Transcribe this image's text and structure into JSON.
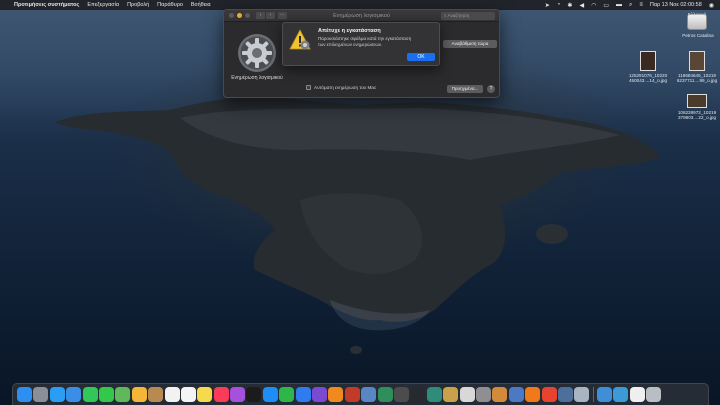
{
  "menubar": {
    "apple": "",
    "app_name": "Προτιμήσεις συστήματος",
    "items": [
      "Επεξεργασία",
      "Προβολή",
      "Παράθυρο",
      "Βοήθεια"
    ],
    "clock": "Παρ 13 Νοε  02:00:58",
    "input_language": "Ελληνικά"
  },
  "desktop": {
    "drive": {
      "label": "Petros Catalina"
    },
    "files": [
      {
        "label": "125291076_10220 450043....14_o.jpg"
      },
      {
        "label": "118684646_10219 6237711....99_o.jpg"
      },
      {
        "label": "106239972_10219 379803....22_o.jpg"
      }
    ]
  },
  "window": {
    "title": "Ενημέρωση λογισμικού",
    "search_placeholder": "Αναζήτηση",
    "pref_label": "Ενημέρωση λογισμικού",
    "update_button": "Αναβάθμιση τώρα",
    "auto_update_label": "Αυτόματη ενημέρωση του Mac",
    "advanced_button": "Προηγμένα...",
    "help_button": "?"
  },
  "alert": {
    "title": "Απέτυχε η εγκατάσταση",
    "message": "Παρουσιάστηκε σφάλμα κατά την εγκατάσταση των επιλεγμένων ενημερώσεων.",
    "ok_button": "OK"
  },
  "dock": {
    "icons": [
      {
        "name": "finder-icon",
        "color": "#2f8ff0"
      },
      {
        "name": "launchpad-icon",
        "color": "#8a8f98"
      },
      {
        "name": "safari-icon",
        "color": "#2a9df4"
      },
      {
        "name": "mail-icon",
        "color": "#3a8ee6"
      },
      {
        "name": "facetime-icon",
        "color": "#33c659"
      },
      {
        "name": "messages-icon",
        "color": "#34c84a"
      },
      {
        "name": "maps-icon",
        "color": "#5fb85a"
      },
      {
        "name": "photos-icon",
        "color": "#f5b638"
      },
      {
        "name": "contacts-icon",
        "color": "#b88a52"
      },
      {
        "name": "calendar-icon",
        "color": "#f2f2f2"
      },
      {
        "name": "reminders-icon",
        "color": "#f4f4f4"
      },
      {
        "name": "notes-icon",
        "color": "#f7d94c"
      },
      {
        "name": "music-icon",
        "color": "#fb3b5a"
      },
      {
        "name": "podcasts-icon",
        "color": "#a451dd"
      },
      {
        "name": "apple-tv-icon",
        "color": "#1b1b1d"
      },
      {
        "name": "app-store-icon",
        "color": "#1c8ef5"
      },
      {
        "name": "numbers-icon",
        "color": "#2fb64b"
      },
      {
        "name": "keynote-icon",
        "color": "#2f7bf0"
      },
      {
        "name": "imovie-icon",
        "color": "#7b4ad3"
      },
      {
        "name": "vlc-icon",
        "color": "#f08a1c"
      },
      {
        "name": "photo-booth-icon",
        "color": "#c23a2a"
      },
      {
        "name": "preview-icon",
        "color": "#5a86c4"
      },
      {
        "name": "sketchup-icon",
        "color": "#2f8f5a"
      },
      {
        "name": "disk-utility-icon",
        "color": "#4c4c4c"
      },
      {
        "name": "speedtest-icon",
        "color": "#262a2f"
      },
      {
        "name": "time-machine-icon",
        "color": "#2f8c7a"
      },
      {
        "name": "tools-icon",
        "color": "#c8a14a"
      },
      {
        "name": "script-editor-icon",
        "color": "#d8d8d8"
      },
      {
        "name": "system-preferences-icon",
        "color": "#8e8e93"
      },
      {
        "name": "archive-utility-icon",
        "color": "#d38a3a"
      },
      {
        "name": "migration-assistant-icon",
        "color": "#4c79c4"
      },
      {
        "name": "firefox-icon",
        "color": "#f0791c"
      },
      {
        "name": "chrome-icon",
        "color": "#e8432f"
      },
      {
        "name": "airdrop-icon",
        "color": "#4d6f9c"
      },
      {
        "name": "scanner-icon",
        "color": "#a9b4c2"
      },
      {
        "name": "finder-window-icon",
        "color": "#3e8ed8"
      },
      {
        "name": "folder-icon",
        "color": "#3c9bd7"
      },
      {
        "name": "document-icon",
        "color": "#efefef"
      },
      {
        "name": "trash-icon",
        "color": "#b9bec4"
      }
    ]
  }
}
